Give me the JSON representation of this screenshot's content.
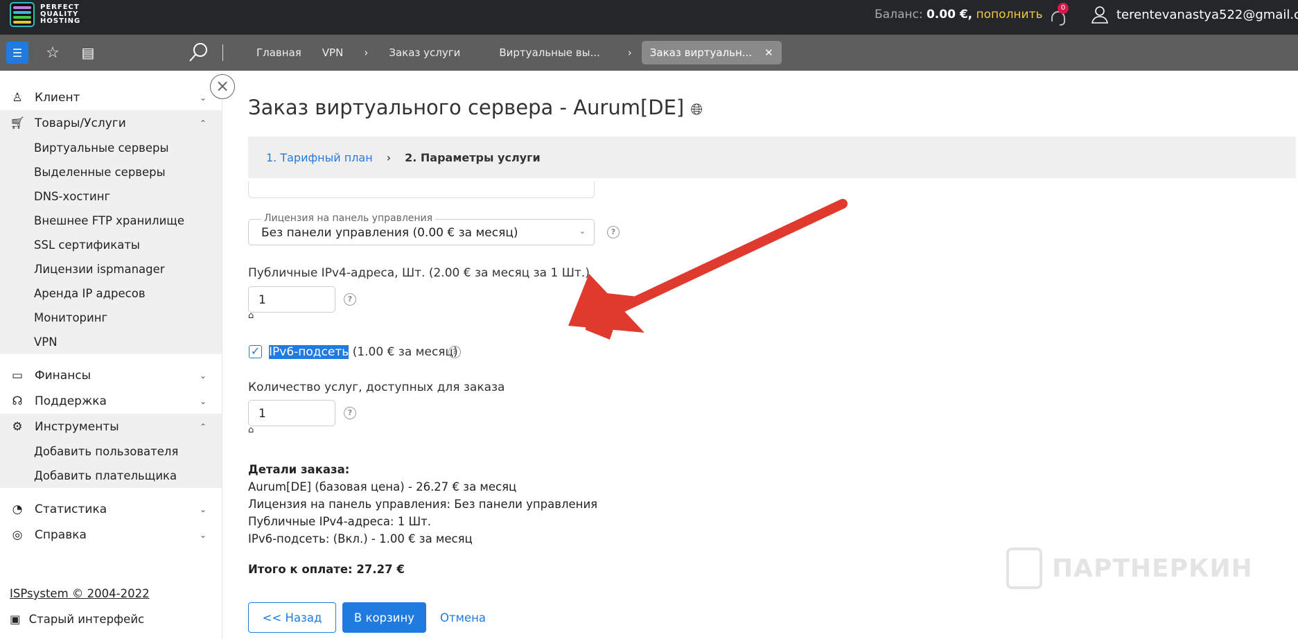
{
  "header": {
    "logo_text": [
      "PERFECT",
      "QUALITY",
      "HOSTING"
    ],
    "balance_label": "Баланс:",
    "balance_value": "0.00 €,",
    "topup": "пополнить",
    "notifications": "0",
    "email": "terentevanastya522@gmail.com"
  },
  "breadcrumbs": [
    "Главная",
    "VPN",
    "Заказ услуги",
    "Виртуальные вы...",
    "Заказ виртуальн..."
  ],
  "sidebar": {
    "client": "Клиент",
    "goods": "Товары/Услуги",
    "goods_items": [
      "Виртуальные серверы",
      "Выделенные серверы",
      "DNS-хостинг",
      "Внешнее FTP хранилище",
      "SSL сертификаты",
      "Лицензии ispmanager",
      "Аренда IP адресов",
      "Мониторинг",
      "VPN"
    ],
    "finance": "Финансы",
    "support": "Поддержка",
    "tools": "Инструменты",
    "tools_items": [
      "Добавить пользователя",
      "Добавить плательщика"
    ],
    "stats": "Статистика",
    "help": "Справка",
    "copyright": "ISPsystem © 2004-2022",
    "old_ui": "Старый интерфейс"
  },
  "page": {
    "title": "Заказ виртуального сервера - Aurum[DE]",
    "step1": "1. Тарифный план",
    "step2": "2. Параметры услуги",
    "license_legend": "Лицензия на панель управления",
    "license_value": "Без панели управления (0.00 € за месяц)",
    "ipv4_label": "Публичные IPv4-адреса, Шт. (2.00 € за месяц за 1 Шт.)",
    "ipv4_value": "1",
    "ipv6_label": "IPv6-подсеть",
    "ipv6_price": "(1.00 € за месяц)",
    "qty_label": "Количество услуг, доступных для заказа",
    "qty_value": "1",
    "details_title": "Детали заказа:",
    "details": [
      "Aurum[DE] (базовая цена) - 26.27 € за месяц",
      "Лицензия на панель управления: Без панели управления",
      "Публичные IPv4-адреса: 1 Шт.",
      "IPv6-подсеть: (Вкл.) - 1.00 € за месяц"
    ],
    "total": "Итого к оплате: 27.27 €",
    "back": "<< Назад",
    "cart": "В корзину",
    "cancel": "Отмена"
  },
  "watermark": "ПАРТНЕРКИН",
  "colors": {
    "accent": "#1f7be0",
    "topbar": "#242629",
    "toolbar": "#5e5e5e",
    "arrow": "#e03a2f"
  }
}
